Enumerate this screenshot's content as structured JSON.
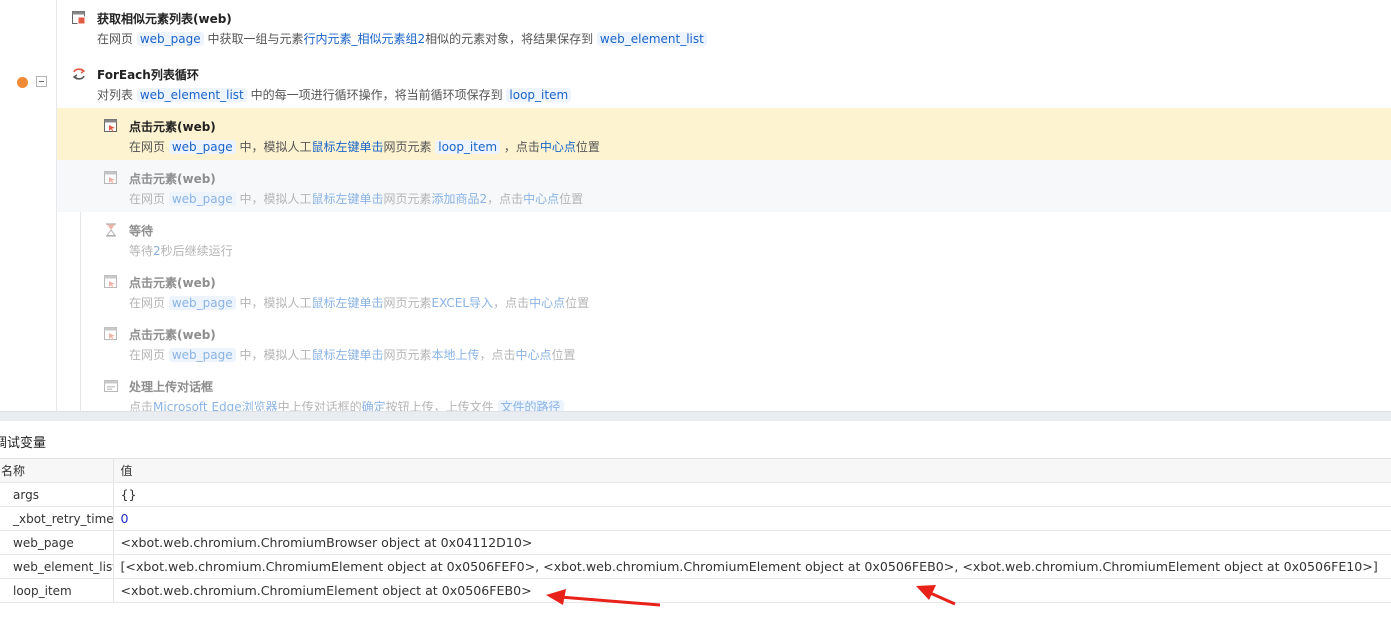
{
  "steps": [
    {
      "title": "获取相似元素列表(web)",
      "icon": "web-list-icon",
      "desc": [
        "在网页 ",
        "web_page",
        " 中获取一组与元素",
        "行内元素_相似元素组2",
        "相似的元素对象，将结果保存到 ",
        "web_element_list"
      ]
    },
    {
      "title": "ForEach列表循环",
      "icon": "loop-icon",
      "desc": [
        "对列表 ",
        "web_element_list",
        " 中的每一项进行循环操作，将当前循环项保存到 ",
        "loop_item"
      ]
    },
    {
      "title": "点击元素(web)",
      "icon": "click-element-icon",
      "desc": [
        "在网页 ",
        "web_page",
        " 中，模拟人工",
        "鼠标左键单击",
        "网页元素 ",
        "loop_item",
        " ，点击",
        "中心点",
        "位置"
      ]
    },
    {
      "title": "点击元素(web)",
      "icon": "click-element-icon",
      "desc": [
        "在网页 ",
        "web_page",
        " 中，模拟人工",
        "鼠标左键单击",
        "网页元素",
        "添加商品2",
        "，点击",
        "中心点",
        "位置"
      ]
    },
    {
      "title": "等待",
      "icon": "hourglass-icon",
      "desc": [
        "等待",
        "2",
        "秒后继续运行"
      ]
    },
    {
      "title": "点击元素(web)",
      "icon": "click-element-icon",
      "desc": [
        "在网页 ",
        "web_page",
        " 中，模拟人工",
        "鼠标左键单击",
        "网页元素",
        "EXCEL导入",
        "，点击",
        "中心点",
        "位置"
      ]
    },
    {
      "title": "点击元素(web)",
      "icon": "click-element-icon",
      "desc": [
        "在网页 ",
        "web_page",
        " 中，模拟人工",
        "鼠标左键单击",
        "网页元素",
        "本地上传",
        "，点击",
        "中心点",
        "位置"
      ]
    },
    {
      "title": "处理上传对话框",
      "icon": "dialog-icon",
      "desc": [
        "点击",
        "Microsoft Edge浏览器",
        "中上传对话框的",
        "确定",
        "按钮上传，上传文件 ",
        "文件的路径"
      ]
    }
  ],
  "debug": {
    "title": "调试变量",
    "col_name": "名称",
    "col_value": "值",
    "rows": [
      {
        "name": "args",
        "value": "{}"
      },
      {
        "name": "_xbot_retry_time",
        "value": "0"
      },
      {
        "name": "web_page",
        "value": "<xbot.web.chromium.ChromiumBrowser object at 0x04112D10>"
      },
      {
        "name": "web_element_list",
        "value": "[<xbot.web.chromium.ChromiumElement object at 0x0506FEF0>, <xbot.web.chromium.ChromiumElement object at 0x0506FEB0>, <xbot.web.chromium.ChromiumElement object at 0x0506FE10>]"
      },
      {
        "name": "loop_item",
        "value": "<xbot.web.chromium.ChromiumElement object at 0x0506FEB0>"
      }
    ]
  },
  "colors": {
    "highlight": "#fdf3d0",
    "variable": "#1a64c8",
    "breakpoint": "#f08a34",
    "annotation_arrow": "#e8221a"
  }
}
